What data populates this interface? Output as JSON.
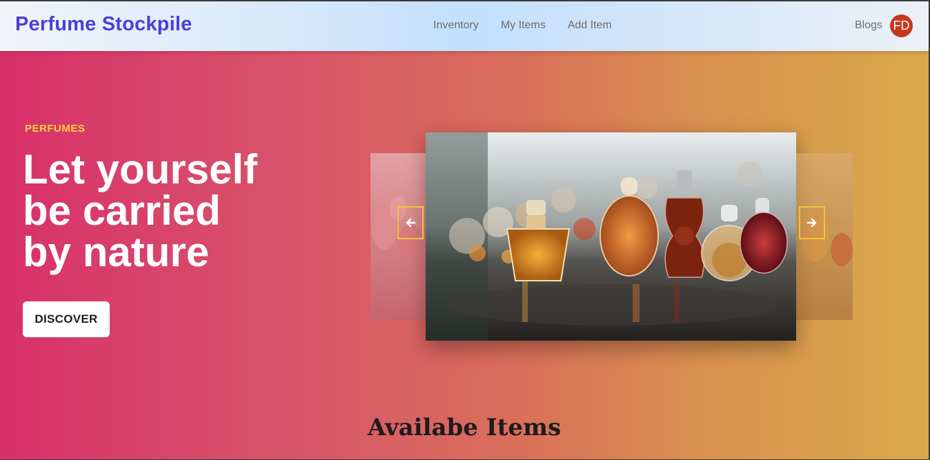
{
  "nav": {
    "brand": "Perfume Stockpile",
    "links": [
      "Inventory",
      "My Items",
      "Add Item"
    ],
    "blogs": "Blogs",
    "avatar_initials": "FD"
  },
  "hero": {
    "eyebrow": "PERFUMES",
    "headline_lines": [
      "Let yourself",
      "be carried",
      "by nature"
    ],
    "cta": "DISCOVER",
    "carousel": {
      "prev_icon": "arrow-left-icon",
      "next_icon": "arrow-right-icon",
      "main_image": "perfume-bottles-photo"
    }
  },
  "section": {
    "title": "Availabe Items"
  },
  "colors": {
    "brand": "#4a3fd8",
    "eyebrow": "#ffd23a",
    "avatar_bg": "#c8371c",
    "arrow_border": "#f2c23a",
    "hero_gradient_start": "#d8306a",
    "hero_gradient_end": "#d9aa4a"
  }
}
